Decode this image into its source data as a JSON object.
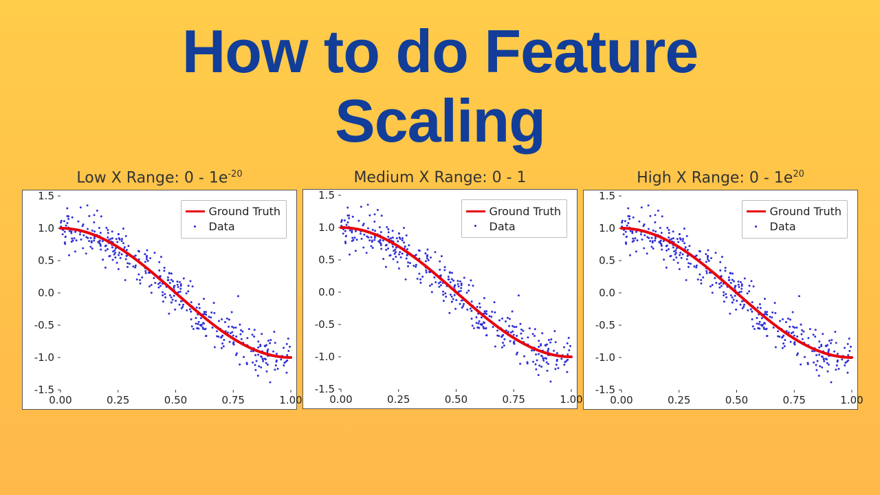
{
  "title_line1": "How to do Feature",
  "title_line2": "Scaling",
  "legend": {
    "truth": "Ground Truth",
    "data": "Data"
  },
  "y_ticks": [
    "-1.5",
    "-1.0",
    "-0.5",
    "0.0",
    "0.5",
    "1.0",
    "1.5"
  ],
  "x_ticks": [
    "0.00",
    "0.25",
    "0.50",
    "0.75",
    "1.00"
  ],
  "chart_data": [
    {
      "type": "scatter+line",
      "title_html": "Low X Range: 0 - 1e<sup>-20</sup>",
      "xlabel": "",
      "ylabel": "",
      "xunit": "1e-20",
      "xlim": [
        0.0,
        1.0
      ],
      "ylim": [
        -1.5,
        1.5
      ],
      "series": [
        {
          "name": "Ground Truth",
          "type": "line",
          "function": "cos(2*pi*x) on normalized 0..1",
          "color": "#e8000b"
        },
        {
          "name": "Data",
          "type": "scatter",
          "note": "cos(2*pi*x) + gaussian noise (sigma≈0.2)",
          "color": "#2f2fd6",
          "n": 400
        }
      ],
      "curve_samples": {
        "x": [
          0.0,
          0.1,
          0.2,
          0.3,
          0.4,
          0.5,
          0.6,
          0.7,
          0.8,
          0.9,
          1.0
        ],
        "y": [
          1.0,
          0.95,
          0.81,
          0.59,
          0.31,
          0.0,
          -0.31,
          -0.59,
          -0.81,
          -0.95,
          -1.0
        ]
      }
    },
    {
      "type": "scatter+line",
      "title_html": "Medium X Range: 0 - 1",
      "xlabel": "",
      "ylabel": "",
      "xunit": "",
      "xlim": [
        0.0,
        1.0
      ],
      "ylim": [
        -1.5,
        1.5
      ],
      "series": [
        {
          "name": "Ground Truth",
          "type": "line",
          "function": "cos(2*pi*x)",
          "color": "#e8000b"
        },
        {
          "name": "Data",
          "type": "scatter",
          "note": "cos(2*pi*x) + gaussian noise (sigma≈0.2)",
          "color": "#2f2fd6",
          "n": 400
        }
      ],
      "curve_samples": {
        "x": [
          0.0,
          0.1,
          0.2,
          0.3,
          0.4,
          0.5,
          0.6,
          0.7,
          0.8,
          0.9,
          1.0
        ],
        "y": [
          1.0,
          0.95,
          0.81,
          0.59,
          0.31,
          0.0,
          -0.31,
          -0.59,
          -0.81,
          -0.95,
          -1.0
        ]
      }
    },
    {
      "type": "scatter+line",
      "title_html": "High X Range: 0 - 1e<sup>20</sup>",
      "xlabel": "",
      "ylabel": "",
      "xunit": "1e20",
      "xlim": [
        0.0,
        1.0
      ],
      "ylim": [
        -1.5,
        1.5
      ],
      "series": [
        {
          "name": "Ground Truth",
          "type": "line",
          "function": "cos(2*pi*x) on normalized 0..1",
          "color": "#e8000b"
        },
        {
          "name": "Data",
          "type": "scatter",
          "note": "cos(2*pi*x) + gaussian noise (sigma≈0.2)",
          "color": "#2f2fd6",
          "n": 400
        }
      ],
      "curve_samples": {
        "x": [
          0.0,
          0.1,
          0.2,
          0.3,
          0.4,
          0.5,
          0.6,
          0.7,
          0.8,
          0.9,
          1.0
        ],
        "y": [
          1.0,
          0.95,
          0.81,
          0.59,
          0.31,
          0.0,
          -0.31,
          -0.59,
          -0.81,
          -0.95,
          -1.0
        ]
      }
    }
  ]
}
